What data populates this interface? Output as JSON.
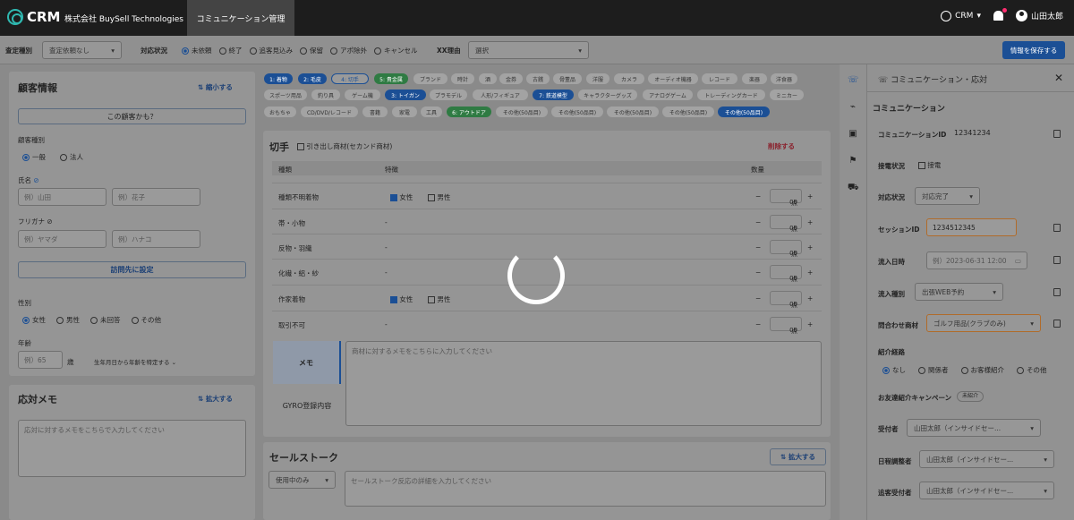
{
  "header": {
    "logo": "CRM",
    "company": "株式会社 BuySell Technologies",
    "active_tab": "コミュニケーション管理",
    "crm_switch": "CRM",
    "user": "山田太郎"
  },
  "filter": {
    "assessment_label": "査定種別",
    "assessment_value": "査定依頼なし",
    "status_label": "対応状況",
    "status_options": [
      "未依頼",
      "終了",
      "追客見込み",
      "保留",
      "アポ除外",
      "キャンセル"
    ],
    "reason_label": "XX理由",
    "reason_placeholder": "選択",
    "save_button": "情報を保存する"
  },
  "customer": {
    "title": "顧客情報",
    "collapse": "縮小する",
    "maybe_button": "この顧客かも？",
    "type_label": "顧客種別",
    "type_options": [
      "一般",
      "法人"
    ],
    "name_label": "氏名",
    "last_name_ph": "例）山田",
    "first_name_ph": "例）花子",
    "kana_label": "フリガナ",
    "last_kana_ph": "例）ヤマダ",
    "first_kana_ph": "例）ハナコ",
    "visit_button": "訪問先に設定",
    "gender_label": "性別",
    "gender_options": [
      "女性",
      "男性",
      "未回答",
      "その他"
    ],
    "age_label": "年齢",
    "age_ph": "例）65",
    "age_unit": "歳",
    "birth_link": "生年月日から年齢を特定する"
  },
  "memo": {
    "title": "応対メモ",
    "expand": "拡大する",
    "placeholder": "応対に対するメモをこちらで入力してください"
  },
  "tags": {
    "row1": [
      "1: 着物",
      "2: 毛皮",
      "4: 切手",
      "5: 貴金属",
      "ブランド",
      "時計",
      "酒",
      "金券",
      "古銭",
      "骨董品",
      "洋服",
      "カメラ",
      "オーディオ機器",
      "レコード",
      "楽器",
      "洋食器"
    ],
    "row2": [
      "スポーツ用品",
      "釣り具",
      "ゲーム機",
      "3: トイガン",
      "プラモデル",
      "人形/フィギュア",
      "7: 鉄道模型",
      "キャラクターグッズ",
      "アナログゲーム",
      "トレーディングカード",
      "ミニカー"
    ],
    "row3": [
      "おもちゃ",
      "CD/DVD/レコード",
      "書籍",
      "家電",
      "工具",
      "6: アウトドア",
      "その他(50品目)",
      "その他(50品目)",
      "その他(50品目)",
      "その他(50品目)",
      "その他(50品目)"
    ]
  },
  "item": {
    "title": "切手",
    "take_out": "引き出し商材(セカンド商材)",
    "delete": "削除する",
    "columns": [
      "種類",
      "特徴",
      "数量"
    ],
    "rows": [
      {
        "name": "種類不明着物",
        "female": true,
        "qty": "00"
      },
      {
        "name": "帯・小物",
        "feature": "-",
        "qty": "00"
      },
      {
        "name": "反物・羽織",
        "feature": "-",
        "qty": "00"
      },
      {
        "name": "化繊・絽・紗",
        "feature": "-",
        "qty": "00"
      },
      {
        "name": "作家着物",
        "female": true,
        "qty": "00"
      },
      {
        "name": "取引不可",
        "feature": "-",
        "qty": "00"
      }
    ],
    "female_label": "女性",
    "male_label": "男性",
    "unit": "点",
    "memo_tab": "メモ",
    "gyro_tab": "GYRO登録内容",
    "memo_placeholder": "商材に対するメモをこちらに入力してください"
  },
  "sales": {
    "title": "セールストーク",
    "expand": "拡大する",
    "select": "使用中のみ",
    "placeholder": "セールストーク反応の詳細を入力してください"
  },
  "right": {
    "title": "コミュニケーション・応対",
    "section": "コミュニケーション",
    "comm_id_label": "コミュニケーションID",
    "comm_id": "12341234",
    "call_label": "接電状況",
    "call_value": "接電",
    "status_label": "対応状況",
    "status_value": "対応完了",
    "session_label": "セッションID",
    "session_value": "1234512345",
    "inflow_date_label": "流入日時",
    "inflow_date_ph": "例）2023-06-31 12:00",
    "inflow_type_label": "流入種別",
    "inflow_type_value": "出張WEB予約",
    "inquiry_label": "問合わせ商材",
    "inquiry_value": "ゴルフ用品(クラブのみ)",
    "route_label": "紹介経路",
    "route_options": [
      "なし",
      "関係者",
      "お客様紹介",
      "その他"
    ],
    "campaign_label": "お友達紹介キャンペーン",
    "campaign_badge": "未紹介",
    "receiver_label": "受付者",
    "receiver_value": "山田太郎（インサイドセー...",
    "scheduler_label": "日程調整者",
    "scheduler_value": "山田太郎（インサイドセー...",
    "follow_label": "追客受付者",
    "follow_value": "山田太郎（インサイドセー..."
  }
}
